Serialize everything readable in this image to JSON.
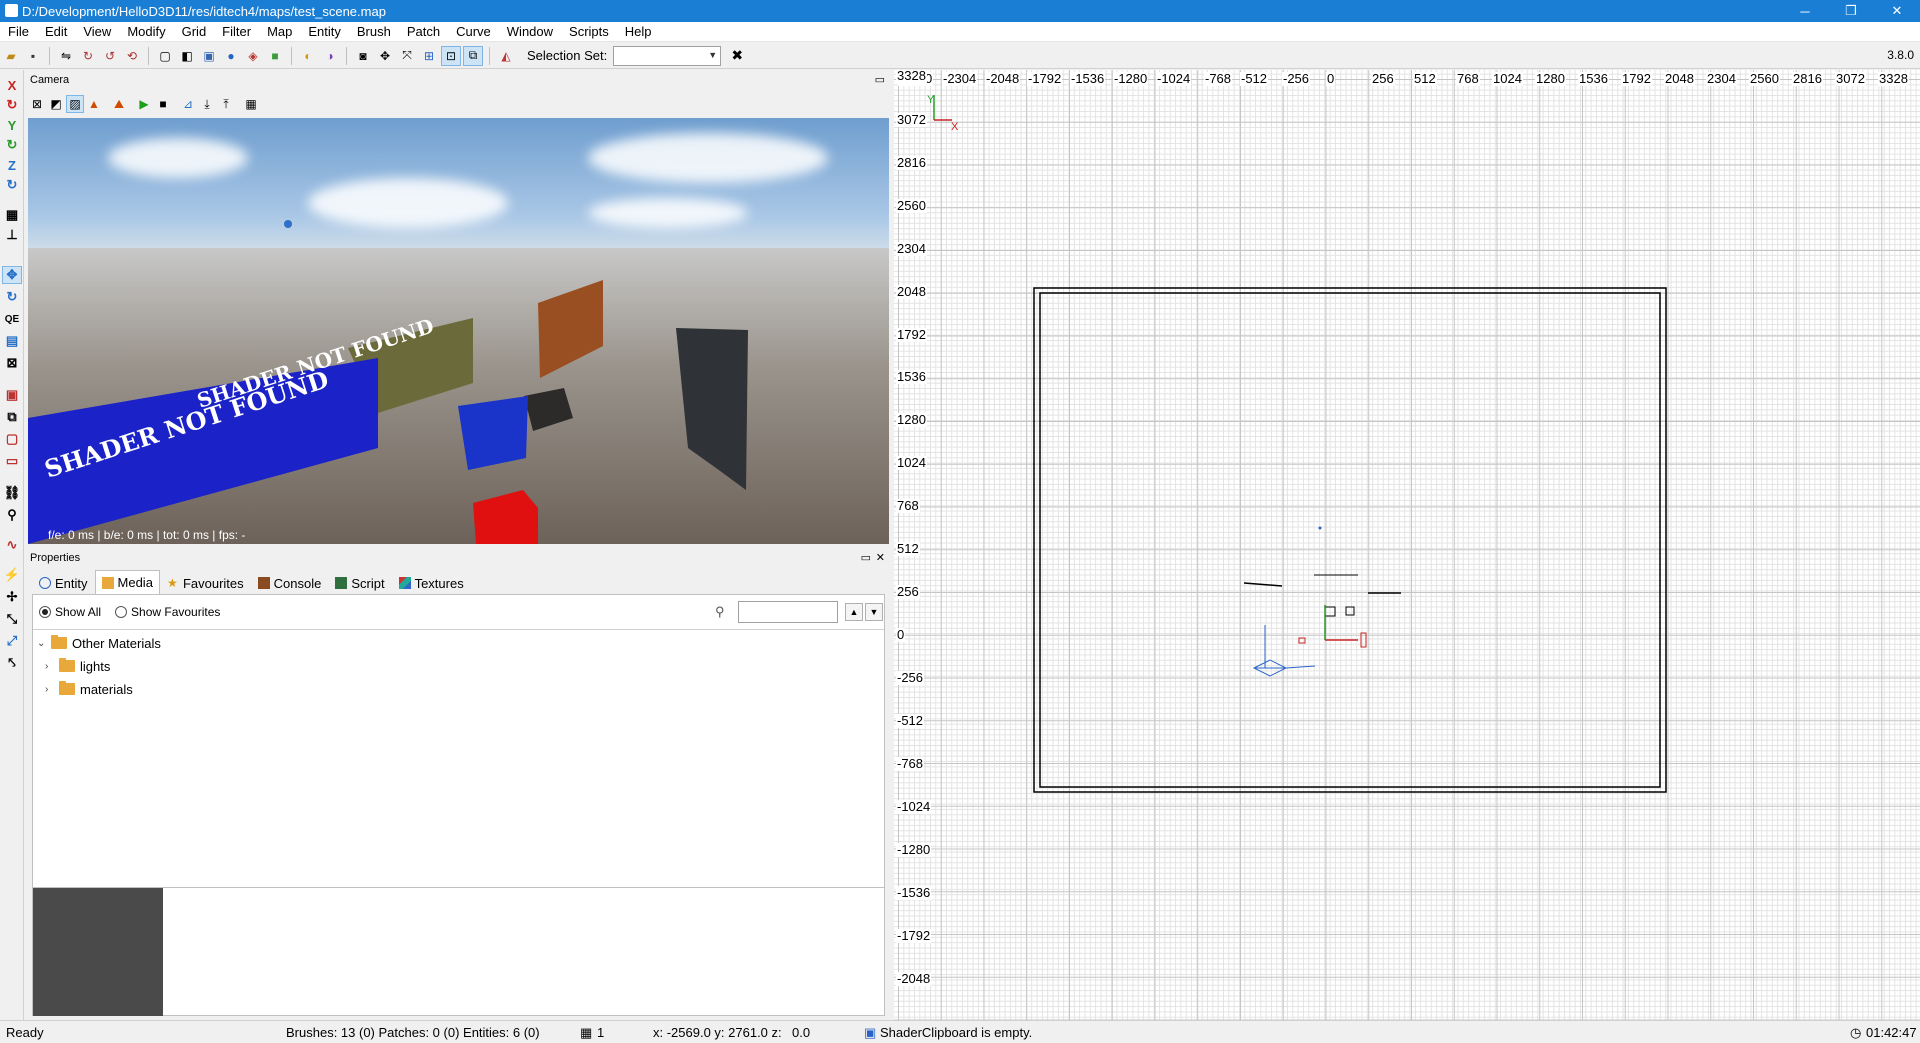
{
  "window": {
    "title": "D:/Development/HelloD3D11/res/idtech4/maps/test_scene.map",
    "controls": [
      "─",
      "❐",
      "✕"
    ]
  },
  "menubar": [
    "File",
    "Edit",
    "View",
    "Modify",
    "Grid",
    "Filter",
    "Map",
    "Entity",
    "Brush",
    "Patch",
    "Curve",
    "Window",
    "Scripts",
    "Help"
  ],
  "toolbar": {
    "selection_set_label": "Selection Set:",
    "selection_set_value": "",
    "version": "3.8.0"
  },
  "camera": {
    "panel_title": "Camera",
    "stats": "f/e: 0 ms | b/e: 0 ms | tot: 0 ms | fps: -",
    "shader_text": "SHADER NOT FOUND"
  },
  "properties": {
    "panel_title": "Properties",
    "tabs": [
      "Entity",
      "Media",
      "Favourites",
      "Console",
      "Script",
      "Textures"
    ],
    "active_tab": "Media",
    "show_all_label": "Show All",
    "show_favourites_label": "Show Favourites",
    "search_value": "",
    "tree": [
      {
        "label": "Other Materials",
        "expanded": true,
        "depth": 0
      },
      {
        "label": "lights",
        "expanded": false,
        "depth": 1
      },
      {
        "label": "materials",
        "expanded": false,
        "depth": 1
      }
    ]
  },
  "ortho_view": {
    "x_ticks": [
      "-2560",
      "-2304",
      "-2048",
      "-1792",
      "-1536",
      "-1280",
      "-1024",
      "-768",
      "-512",
      "-256",
      "0",
      "256",
      "512",
      "768",
      "1024",
      "1280",
      "1536",
      "1792",
      "2048",
      "2304",
      "2560",
      "2816",
      "3072",
      "3328"
    ],
    "y_ticks": [
      "3328",
      "3072",
      "2816",
      "2560",
      "2304",
      "2048",
      "1792",
      "1536",
      "1280",
      "1024",
      "768",
      "512",
      "256",
      "0",
      "-256",
      "-512",
      "-768",
      "-1024",
      "-1280",
      "-1536",
      "-1792",
      "-2048"
    ],
    "axis_x_label": "X",
    "axis_y_label": "Y"
  },
  "statusbar": {
    "ready": "Ready",
    "counts": "Brushes: 13 (0) Patches: 0 (0) Entities: 6 (0)",
    "grid": "1",
    "coords": "x: -2569.0 y: 2761.0 z:",
    "coords_z": "0.0",
    "clipboard": "ShaderClipboard is empty.",
    "time": "01:42:47"
  }
}
